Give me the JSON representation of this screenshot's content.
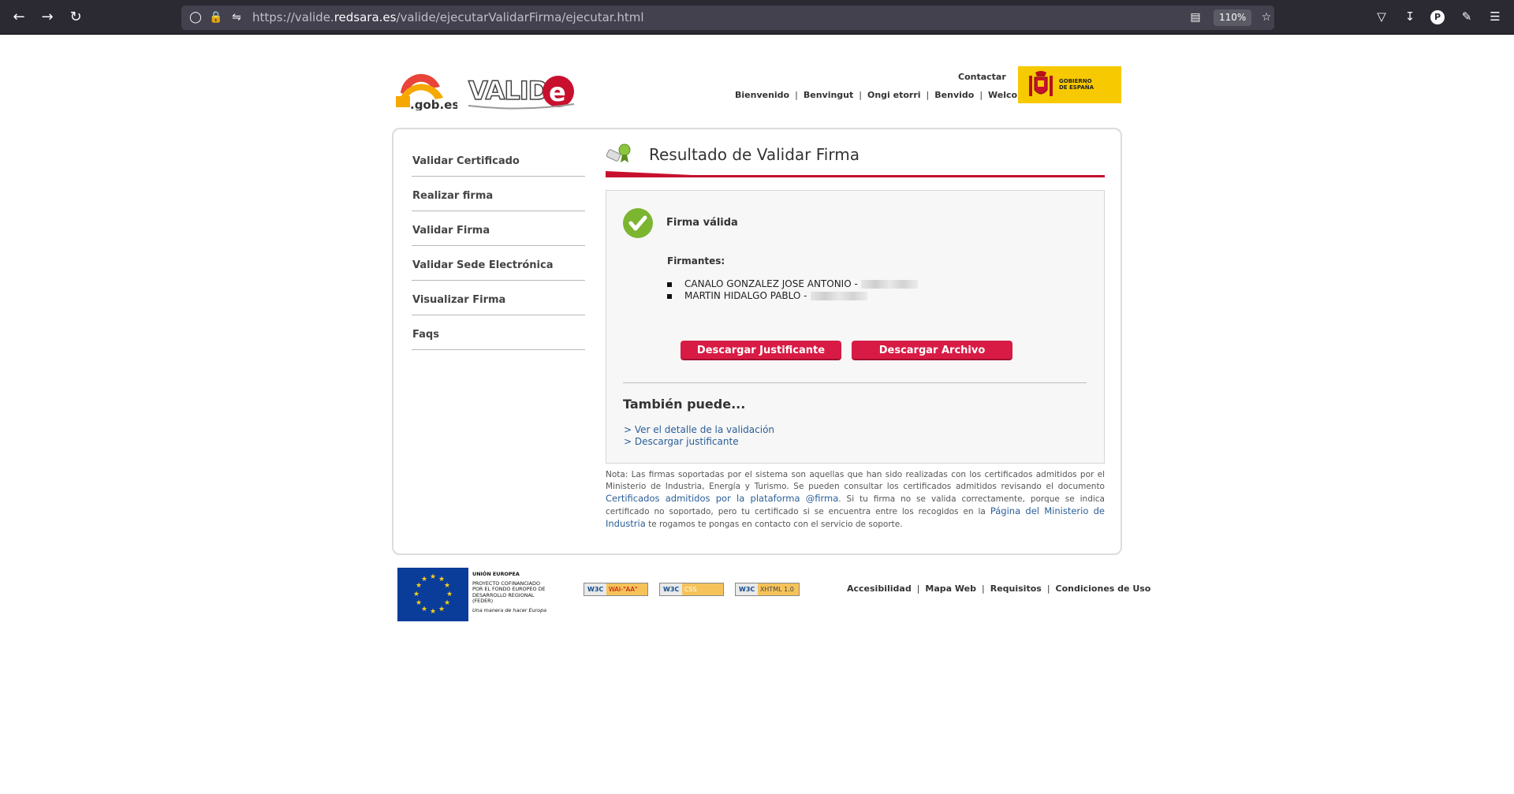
{
  "browser": {
    "url_prefix": "https://valide.",
    "url_domain": "redsara.es",
    "url_path": "/valide/ejecutarValidarFirma/ejecutar.html",
    "zoom": "110%",
    "profile_initial": "P"
  },
  "header": {
    "logo_gob_text": ".gob.es",
    "logo_valide_text": "VALID",
    "logo_valide_e": "e",
    "contactar": "Contactar",
    "languages": [
      "Bienvenido",
      "Benvingut",
      "Ongi etorri",
      "Benvido",
      "Welcome"
    ],
    "gobierno": [
      "GOBIERNO",
      "DE ESPAÑA"
    ]
  },
  "sidebar": {
    "items": [
      {
        "label": "Validar Certificado"
      },
      {
        "label": "Realizar firma"
      },
      {
        "label": "Validar Firma"
      },
      {
        "label": "Validar Sede Electrónica"
      },
      {
        "label": "Visualizar Firma"
      },
      {
        "label": "Faqs"
      }
    ]
  },
  "main": {
    "title": "Resultado de Validar Firma",
    "status": "Firma válida",
    "firmantes_label": "Firmantes:",
    "firmantes": [
      "CANALO GONZALEZ JOSE ANTONIO -",
      "MARTIN HIDALGO PABLO -"
    ],
    "btn_justificante": "Descargar Justificante",
    "btn_archivo": "Descargar Archivo",
    "tambien": "También puede...",
    "link_detalle": "> Ver el detalle de la validación",
    "link_justificante": "> Descargar justificante"
  },
  "nota": {
    "part1": "Nota: Las firmas soportadas por el sistema son aquellas que han sido realizadas con los certificados admitidos por el Ministerio de Industria, Energía y Turismo. Se pueden consultar los certificados admitidos revisando el documento",
    "link1": "Certificados admitidos por la plataforma @firma",
    "part2": ". Si tu firma no se valida correctamente, porque se indica certificado no soportado, pero tu certificado si se encuentra entre los recogidos en la",
    "link2": "Página del Ministerio de Industria",
    "part3": "te rogamos te pongas en contacto con el servicio de soporte."
  },
  "footer": {
    "eu_lines": [
      "UNIÓN EUROPEA",
      "PROYECTO COFINANCIADO",
      "POR EL FONDO EUROPEO DE",
      "DESARROLLO REGIONAL",
      "(FEDER)",
      "Una manera de hacer Europa"
    ],
    "badges": [
      {
        "w3c": "W3C",
        "label": "WAI-\"AA\""
      },
      {
        "w3c": "W3C",
        "label": "CSS"
      },
      {
        "w3c": "W3C",
        "label": "XHTML 1.0"
      }
    ],
    "links": [
      "Accesibilidad",
      "Mapa Web",
      "Requisitos",
      "Condiciones de Uso"
    ]
  },
  "colors": {
    "accent": "#c8102e",
    "button": "#d81b45",
    "check": "#7cb530",
    "link": "#2a5e98"
  }
}
